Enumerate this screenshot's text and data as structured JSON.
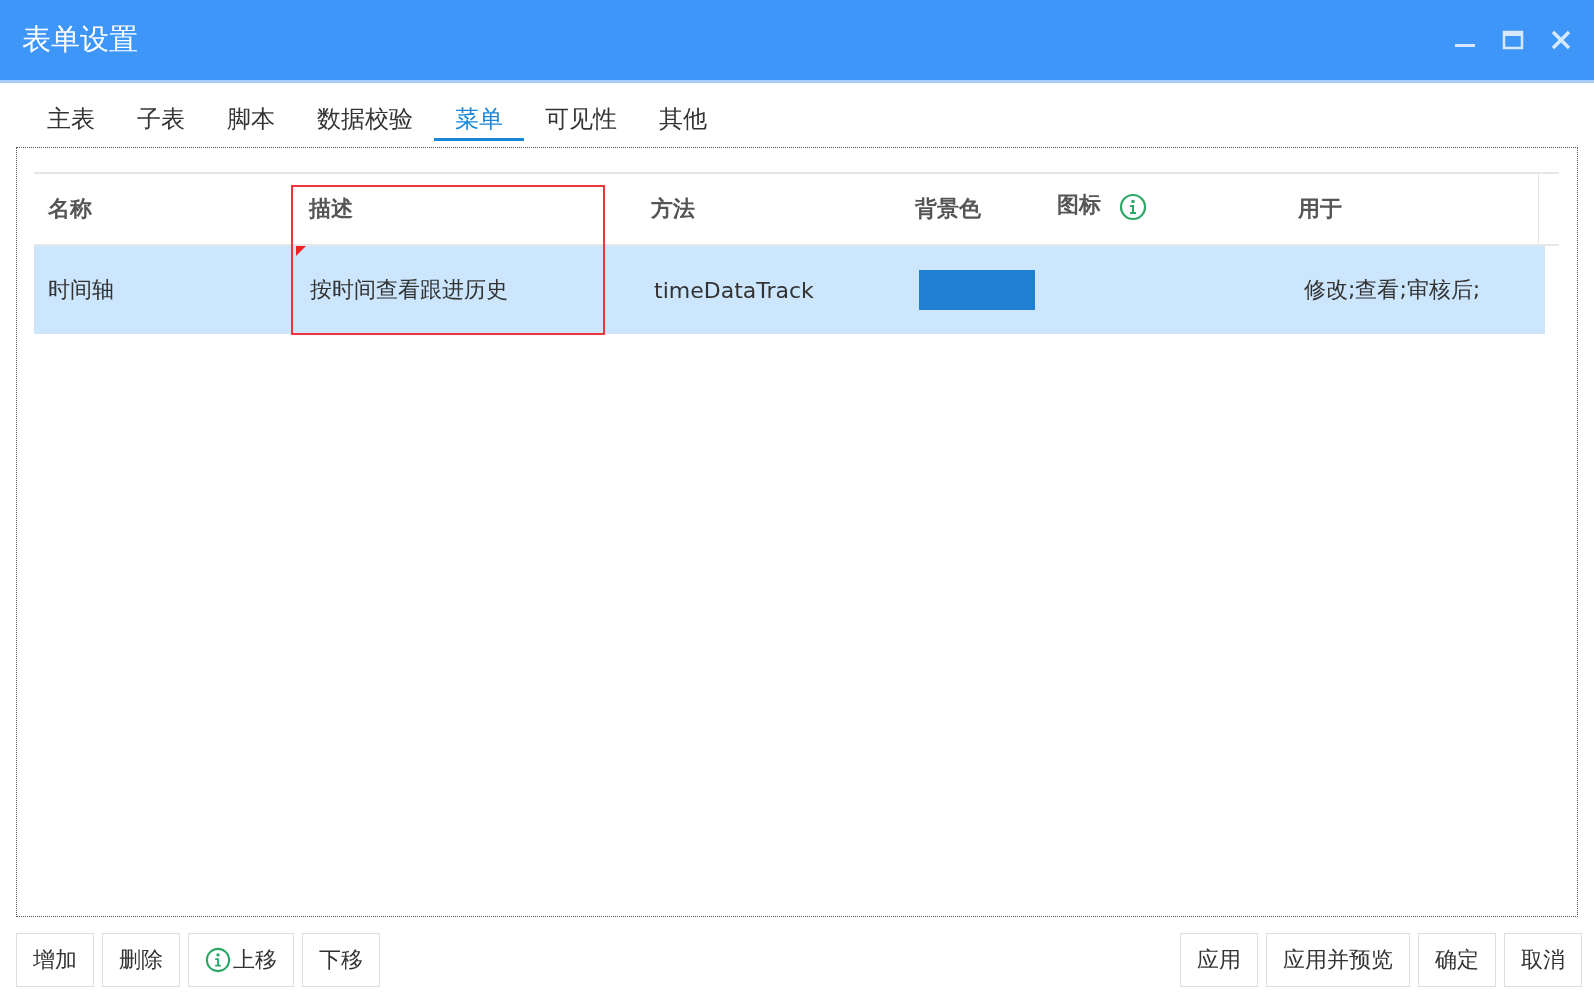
{
  "window": {
    "title": "表单设置"
  },
  "tabs": [
    {
      "label": "主表",
      "selected": false
    },
    {
      "label": "子表",
      "selected": false
    },
    {
      "label": "脚本",
      "selected": false
    },
    {
      "label": "数据校验",
      "selected": false
    },
    {
      "label": "菜单",
      "selected": true
    },
    {
      "label": "可见性",
      "selected": false
    },
    {
      "label": "其他",
      "selected": false
    }
  ],
  "table": {
    "columns": [
      {
        "label": "名称",
        "kind": "plain",
        "highlighted": false
      },
      {
        "label": "描述",
        "kind": "plain",
        "highlighted": true
      },
      {
        "label": "方法",
        "kind": "plain",
        "highlighted": false
      },
      {
        "label": "背景色",
        "kind": "plain",
        "highlighted": false
      },
      {
        "label": "图标",
        "kind": "help",
        "highlighted": false
      },
      {
        "label": "用于",
        "kind": "plain",
        "highlighted": false
      }
    ],
    "rows": [
      {
        "selected": true,
        "name": "时间轴",
        "description": "按时间查看跟进历史",
        "method": "timeDataTrack",
        "color": "#207fd2",
        "used_for": "修改;查看;审核后;"
      }
    ]
  },
  "left_buttons": [
    {
      "label": "增加",
      "kind": "plain"
    },
    {
      "label": "删除",
      "kind": "plain"
    },
    {
      "label": "上移",
      "kind": "help"
    },
    {
      "label": "下移",
      "kind": "plain"
    }
  ],
  "right_buttons": [
    {
      "label": "应用"
    },
    {
      "label": "应用并预览"
    },
    {
      "label": "确定"
    },
    {
      "label": "取消"
    }
  ]
}
